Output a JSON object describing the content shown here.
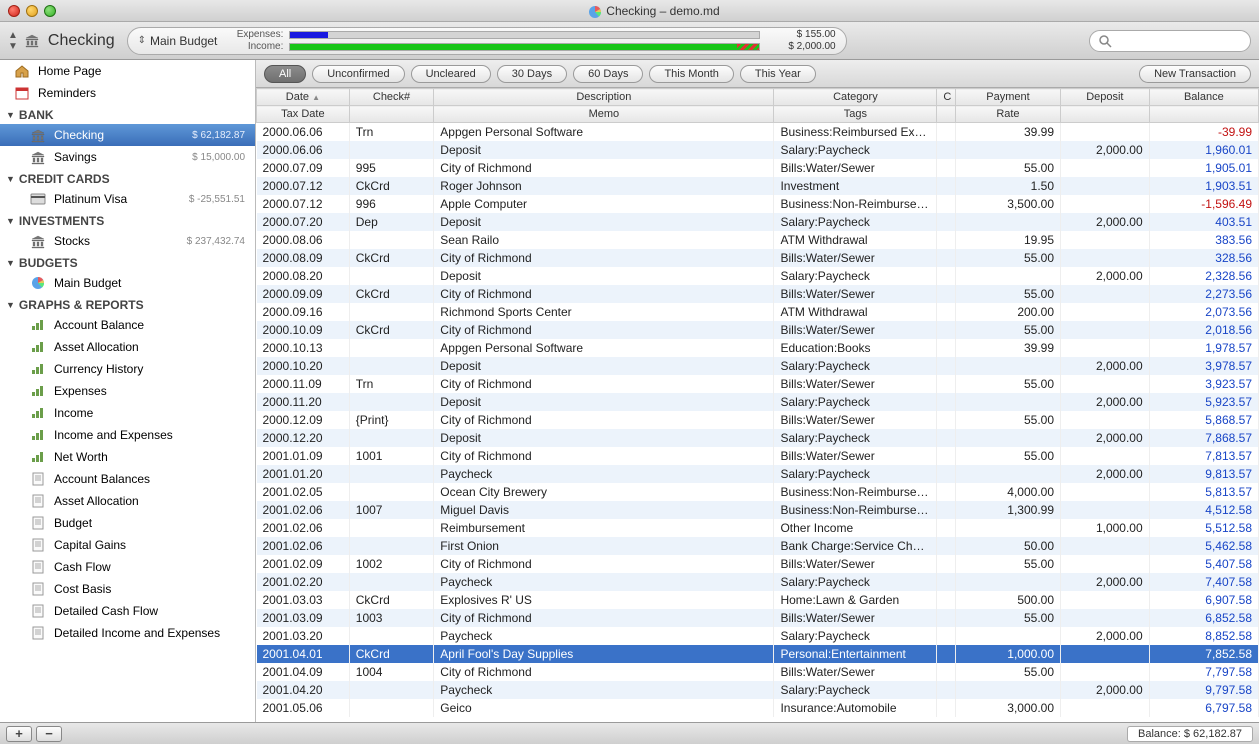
{
  "window": {
    "title": "Checking – demo.md"
  },
  "toolbar": {
    "account": "Checking",
    "budget_name": "Main Budget",
    "expenses_label": "Expenses:",
    "income_label": "Income:",
    "expenses_amount": "$ 155.00",
    "income_amount": "$ 2,000.00",
    "search_placeholder": ""
  },
  "sidebar": {
    "top": [
      {
        "icon": "home",
        "label": "Home Page"
      },
      {
        "icon": "reminders",
        "label": "Reminders"
      }
    ],
    "sections": [
      {
        "header": "BANK",
        "items": [
          {
            "icon": "bank",
            "label": "Checking",
            "amount": "$ 62,182.87",
            "selected": true
          },
          {
            "icon": "bank",
            "label": "Savings",
            "amount": "$ 15,000.00"
          }
        ]
      },
      {
        "header": "CREDIT CARDS",
        "items": [
          {
            "icon": "card",
            "label": "Platinum Visa",
            "amount": "$ -25,551.51"
          }
        ]
      },
      {
        "header": "INVESTMENTS",
        "items": [
          {
            "icon": "bank",
            "label": "Stocks",
            "amount": "$ 237,432.74"
          }
        ]
      },
      {
        "header": "BUDGETS",
        "items": [
          {
            "icon": "pie",
            "label": "Main Budget"
          }
        ]
      },
      {
        "header": "GRAPHS & REPORTS",
        "items": [
          {
            "icon": "graph",
            "label": "Account Balance"
          },
          {
            "icon": "graph",
            "label": "Asset Allocation"
          },
          {
            "icon": "graph",
            "label": "Currency History"
          },
          {
            "icon": "graph",
            "label": "Expenses"
          },
          {
            "icon": "graph",
            "label": "Income"
          },
          {
            "icon": "graph",
            "label": "Income and Expenses"
          },
          {
            "icon": "graph",
            "label": "Net Worth"
          },
          {
            "icon": "report",
            "label": "Account Balances"
          },
          {
            "icon": "report",
            "label": "Asset Allocation"
          },
          {
            "icon": "report",
            "label": "Budget"
          },
          {
            "icon": "report",
            "label": "Capital Gains"
          },
          {
            "icon": "report",
            "label": "Cash Flow"
          },
          {
            "icon": "report",
            "label": "Cost Basis"
          },
          {
            "icon": "report",
            "label": "Detailed Cash Flow"
          },
          {
            "icon": "report",
            "label": "Detailed Income and Expenses"
          }
        ]
      }
    ]
  },
  "filters": {
    "pills": [
      "All",
      "Unconfirmed",
      "Uncleared",
      "30 Days",
      "60 Days",
      "This Month",
      "This Year"
    ],
    "active": 0,
    "new_label": "New Transaction"
  },
  "columns": {
    "row1": [
      "Date",
      "Check#",
      "Description",
      "Category",
      "C",
      "Payment",
      "Deposit",
      "Balance"
    ],
    "row2": [
      "Tax Date",
      "",
      "Memo",
      "Tags",
      "",
      "Rate",
      "",
      ""
    ]
  },
  "rows": [
    {
      "date": "2000.06.06",
      "check": "Trn",
      "desc": "Appgen Personal Software",
      "cat": "Business:Reimbursed Exper",
      "pay": "39.99",
      "dep": "",
      "bal": "-39.99",
      "neg": true
    },
    {
      "date": "2000.06.06",
      "check": "",
      "desc": "Deposit",
      "cat": "Salary:Paycheck",
      "pay": "",
      "dep": "2,000.00",
      "bal": "1,960.01"
    },
    {
      "date": "2000.07.09",
      "check": "995",
      "desc": "City of Richmond",
      "cat": "Bills:Water/Sewer",
      "pay": "55.00",
      "dep": "",
      "bal": "1,905.01"
    },
    {
      "date": "2000.07.12",
      "check": "CkCrd",
      "desc": "Roger Johnson",
      "cat": "Investment",
      "pay": "1.50",
      "dep": "",
      "bal": "1,903.51"
    },
    {
      "date": "2000.07.12",
      "check": "996",
      "desc": "Apple Computer",
      "cat": "Business:Non-Reimbursed E",
      "pay": "3,500.00",
      "dep": "",
      "bal": "-1,596.49",
      "neg": true
    },
    {
      "date": "2000.07.20",
      "check": "Dep",
      "desc": "Deposit",
      "cat": "Salary:Paycheck",
      "pay": "",
      "dep": "2,000.00",
      "bal": "403.51"
    },
    {
      "date": "2000.08.06",
      "check": "",
      "desc": "Sean Railo",
      "cat": "ATM Withdrawal",
      "pay": "19.95",
      "dep": "",
      "bal": "383.56"
    },
    {
      "date": "2000.08.09",
      "check": "CkCrd",
      "desc": "City of Richmond",
      "cat": "Bills:Water/Sewer",
      "pay": "55.00",
      "dep": "",
      "bal": "328.56"
    },
    {
      "date": "2000.08.20",
      "check": "",
      "desc": "Deposit",
      "cat": "Salary:Paycheck",
      "pay": "",
      "dep": "2,000.00",
      "bal": "2,328.56"
    },
    {
      "date": "2000.09.09",
      "check": "CkCrd",
      "desc": "City of Richmond",
      "cat": "Bills:Water/Sewer",
      "pay": "55.00",
      "dep": "",
      "bal": "2,273.56"
    },
    {
      "date": "2000.09.16",
      "check": "",
      "desc": "Richmond Sports Center",
      "cat": "ATM Withdrawal",
      "pay": "200.00",
      "dep": "",
      "bal": "2,073.56"
    },
    {
      "date": "2000.10.09",
      "check": "CkCrd",
      "desc": "City of Richmond",
      "cat": "Bills:Water/Sewer",
      "pay": "55.00",
      "dep": "",
      "bal": "2,018.56"
    },
    {
      "date": "2000.10.13",
      "check": "",
      "desc": "Appgen Personal Software",
      "cat": "Education:Books",
      "pay": "39.99",
      "dep": "",
      "bal": "1,978.57"
    },
    {
      "date": "2000.10.20",
      "check": "",
      "desc": "Deposit",
      "cat": "Salary:Paycheck",
      "pay": "",
      "dep": "2,000.00",
      "bal": "3,978.57"
    },
    {
      "date": "2000.11.09",
      "check": "Trn",
      "desc": "City of Richmond",
      "cat": "Bills:Water/Sewer",
      "pay": "55.00",
      "dep": "",
      "bal": "3,923.57"
    },
    {
      "date": "2000.11.20",
      "check": "",
      "desc": "Deposit",
      "cat": "Salary:Paycheck",
      "pay": "",
      "dep": "2,000.00",
      "bal": "5,923.57"
    },
    {
      "date": "2000.12.09",
      "check": "{Print}",
      "desc": "City of Richmond",
      "cat": "Bills:Water/Sewer",
      "pay": "55.00",
      "dep": "",
      "bal": "5,868.57"
    },
    {
      "date": "2000.12.20",
      "check": "",
      "desc": "Deposit",
      "cat": "Salary:Paycheck",
      "pay": "",
      "dep": "2,000.00",
      "bal": "7,868.57"
    },
    {
      "date": "2001.01.09",
      "check": "1001",
      "desc": "City of Richmond",
      "cat": "Bills:Water/Sewer",
      "pay": "55.00",
      "dep": "",
      "bal": "7,813.57"
    },
    {
      "date": "2001.01.20",
      "check": "",
      "desc": "Paycheck",
      "cat": "Salary:Paycheck",
      "pay": "",
      "dep": "2,000.00",
      "bal": "9,813.57"
    },
    {
      "date": "2001.02.05",
      "check": "",
      "desc": "Ocean City Brewery",
      "cat": "Business:Non-Reimbursed E",
      "pay": "4,000.00",
      "dep": "",
      "bal": "5,813.57"
    },
    {
      "date": "2001.02.06",
      "check": "1007",
      "desc": "Miguel Davis",
      "cat": "Business:Non-Reimbursed E",
      "pay": "1,300.99",
      "dep": "",
      "bal": "4,512.58"
    },
    {
      "date": "2001.02.06",
      "check": "",
      "desc": "Reimbursement",
      "cat": "Other Income",
      "pay": "",
      "dep": "1,000.00",
      "bal": "5,512.58"
    },
    {
      "date": "2001.02.06",
      "check": "",
      "desc": "First Onion",
      "cat": "Bank Charge:Service Charge",
      "pay": "50.00",
      "dep": "",
      "bal": "5,462.58"
    },
    {
      "date": "2001.02.09",
      "check": "1002",
      "desc": "City of Richmond",
      "cat": "Bills:Water/Sewer",
      "pay": "55.00",
      "dep": "",
      "bal": "5,407.58"
    },
    {
      "date": "2001.02.20",
      "check": "",
      "desc": "Paycheck",
      "cat": "Salary:Paycheck",
      "pay": "",
      "dep": "2,000.00",
      "bal": "7,407.58"
    },
    {
      "date": "2001.03.03",
      "check": "CkCrd",
      "desc": "Explosives R' US",
      "cat": "Home:Lawn & Garden",
      "pay": "500.00",
      "dep": "",
      "bal": "6,907.58"
    },
    {
      "date": "2001.03.09",
      "check": "1003",
      "desc": "City of Richmond",
      "cat": "Bills:Water/Sewer",
      "pay": "55.00",
      "dep": "",
      "bal": "6,852.58"
    },
    {
      "date": "2001.03.20",
      "check": "",
      "desc": "Paycheck",
      "cat": "Salary:Paycheck",
      "pay": "",
      "dep": "2,000.00",
      "bal": "8,852.58"
    },
    {
      "date": "2001.04.01",
      "check": "CkCrd",
      "desc": "April Fool's Day Supplies",
      "cat": "Personal:Entertainment",
      "pay": "1,000.00",
      "dep": "",
      "bal": "7,852.58",
      "selected": true
    },
    {
      "date": "2001.04.09",
      "check": "1004",
      "desc": "City of Richmond",
      "cat": "Bills:Water/Sewer",
      "pay": "55.00",
      "dep": "",
      "bal": "7,797.58"
    },
    {
      "date": "2001.04.20",
      "check": "",
      "desc": "Paycheck",
      "cat": "Salary:Paycheck",
      "pay": "",
      "dep": "2,000.00",
      "bal": "9,797.58"
    },
    {
      "date": "2001.05.06",
      "check": "",
      "desc": "Geico",
      "cat": "Insurance:Automobile",
      "pay": "3,000.00",
      "dep": "",
      "bal": "6,797.58"
    }
  ],
  "bottom": {
    "balance_label": "Balance: $ 62,182.87"
  }
}
